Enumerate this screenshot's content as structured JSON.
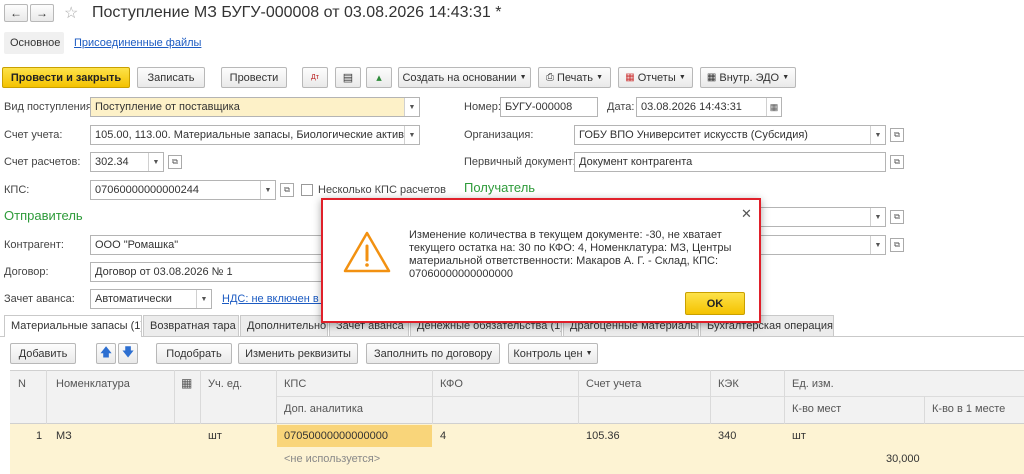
{
  "window": {
    "title": "Поступление МЗ БУГУ-000008 от 03.08.2026 14:43:31 *",
    "tabs": [
      "Основное",
      "Присоединенные файлы"
    ]
  },
  "toolbar": {
    "post_close": "Провести и закрыть",
    "save": "Записать",
    "post": "Провести",
    "create_based": "Создать на основании",
    "print": "Печать",
    "reports": "Отчеты",
    "edo": "Внутр. ЭДО"
  },
  "form": {
    "receipt_type_label": "Вид поступления:",
    "receipt_type": "Поступление от поставщика",
    "account_label": "Счет учета:",
    "account": "105.00, 113.00. Материальные запасы, Биологические активы",
    "settle_label": "Счет расчетов:",
    "settle": "302.34",
    "kps_label": "КПС:",
    "kps": "07060000000000244",
    "multi_kps": "Несколько КПС расчетов",
    "sender_header": "Отправитель",
    "counterparty_label": "Контрагент:",
    "counterparty": "ООО \"Ромашка\"",
    "contract_label": "Договор:",
    "contract": "Договор от 03.08.2026 № 1",
    "advance_label": "Зачет аванса:",
    "advance": "Автоматически",
    "vat_link": "НДС: не включен в с",
    "number_label": "Номер:",
    "number": "БУГУ-000008",
    "date_label": "Дата:",
    "date": "03.08.2026 14:43:31",
    "org_label": "Организация:",
    "org": "ГОБУ ВПО Университет искусств (Субсидия)",
    "primary_doc_label": "Первичный документ:",
    "primary_doc": "Документ контрагента",
    "recipient_header": "Получатель"
  },
  "doc_tabs": [
    "Материальные запасы (1)",
    "Возвратная тара",
    "Дополнительно",
    "Зачет аванса",
    "Денежные обязательства (1)",
    "Драгоценные материалы",
    "Бухгалтерская операция"
  ],
  "table_toolbar": {
    "add": "Добавить",
    "pick": "Подобрать",
    "change": "Изменить реквизиты",
    "fill": "Заполнить по договору",
    "price": "Контроль цен"
  },
  "table": {
    "h_n": "N",
    "h_nom": "Номенклатура",
    "h_unit": "Уч. ед.",
    "h_kps": "КПС",
    "h_kfo": "КФО",
    "h_acc": "Счет учета",
    "h_kek": "КЭК",
    "h_uom": "Ед. изм.",
    "h_analytics": "Доп. аналитика",
    "h_places": "К-во мест",
    "h_per_place": "К-во в 1 месте",
    "row": {
      "n": "1",
      "nom": "МЗ",
      "unit": "шт",
      "kps": "07050000000000000",
      "kfo": "4",
      "acc": "105.36",
      "kek": "340",
      "uom": "шт",
      "analytics": "<не используется>",
      "per_place": "30,000"
    }
  },
  "dialog": {
    "message": "Изменение количества в текущем документе: -30, не хватает текущего остатка на: 30 по КФО: 4, Номенклатура: МЗ, Центры материальной ответственности: Макаров А. Г. - Склад, КПС: 07060000000000000",
    "ok": "OK"
  },
  "colors": {
    "accent_yellow": "#f6c90e",
    "green_header": "#2e9b3a",
    "dialog_border": "#e0202a",
    "warning": "#f29111"
  }
}
